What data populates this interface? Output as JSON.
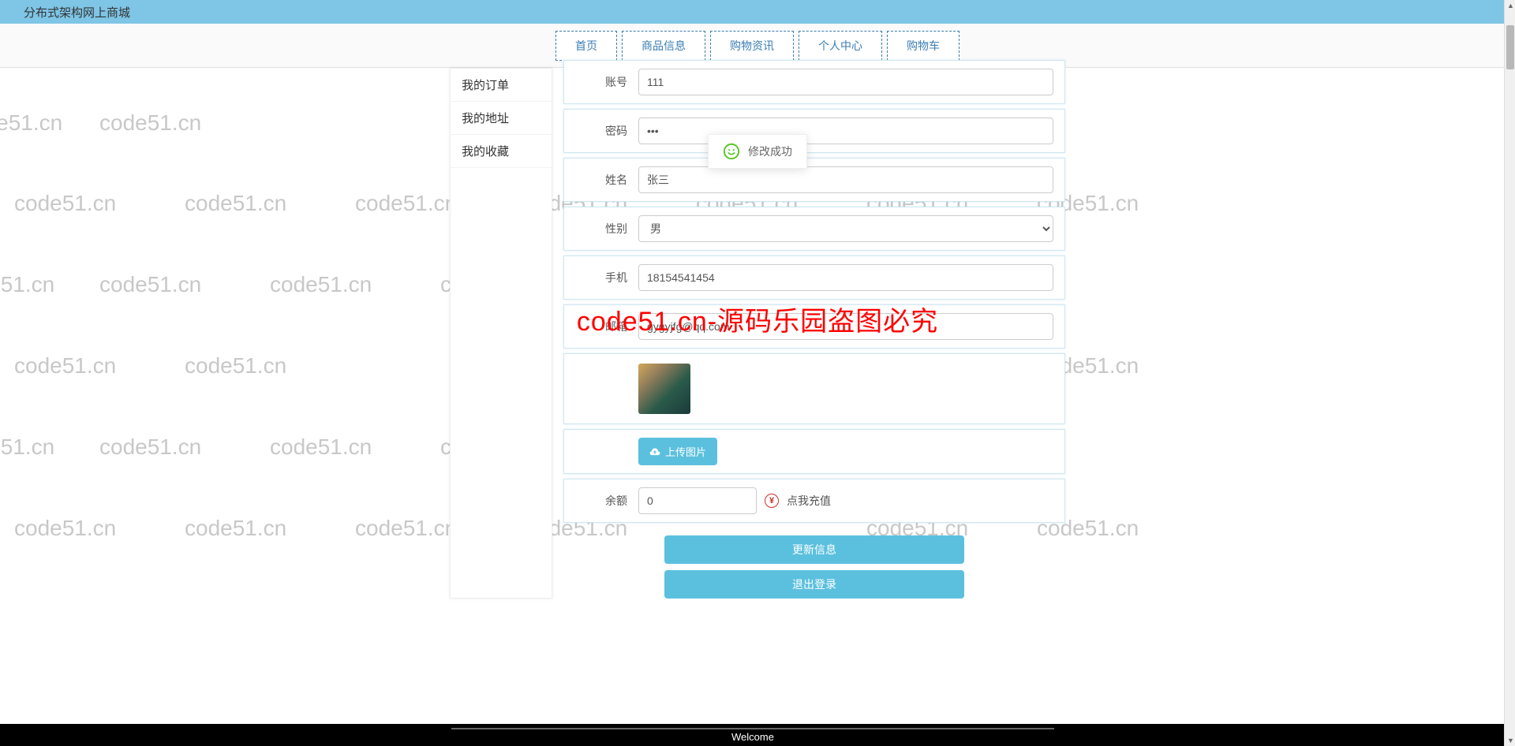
{
  "topbar": {
    "title": "分布式架构网上商城"
  },
  "nav": {
    "items": [
      "首页",
      "商品信息",
      "购物资讯",
      "个人中心",
      "购物车"
    ]
  },
  "sidebar": {
    "items": [
      "我的订单",
      "我的地址",
      "我的收藏"
    ]
  },
  "form": {
    "account": {
      "label": "账号",
      "value": "111"
    },
    "password": {
      "label": "密码",
      "value": "•••"
    },
    "name": {
      "label": "姓名",
      "value": "张三"
    },
    "gender": {
      "label": "性别",
      "value": "男"
    },
    "phone": {
      "label": "手机",
      "value": "18154541454"
    },
    "email": {
      "label": "邮箱",
      "value": "gygyjfg@qq.com"
    },
    "upload": {
      "label": "上传图片"
    },
    "balance": {
      "label": "余额",
      "value": "0",
      "recharge": "点我充值"
    },
    "update_btn": "更新信息",
    "logout_btn": "退出登录"
  },
  "toast": {
    "message": "修改成功"
  },
  "watermark": {
    "text": "code51.cn",
    "big": "code51.cn-源码乐园盗图必究"
  },
  "footer": {
    "text": "Welcome"
  }
}
